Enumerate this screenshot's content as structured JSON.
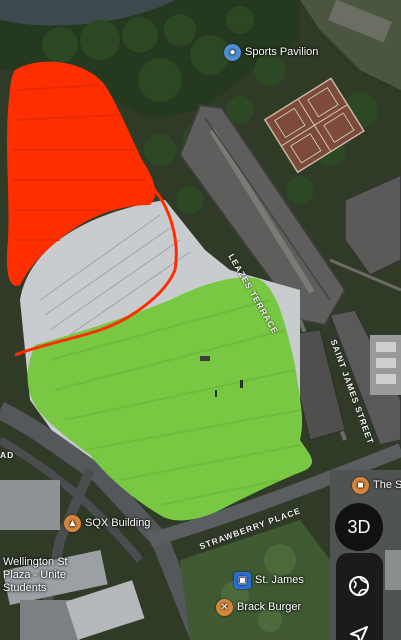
{
  "labels": {
    "sports_pavilion": "Sports Pavilion",
    "sqx_building": "SQX Building",
    "wellington": "Wellington St\nPlaza - Unite\nStudents",
    "st_james": "St. James",
    "brack_burger": "Brack Burger",
    "the_s": "The S"
  },
  "roads": {
    "leazes_terrace": "LEAZES TERRACE",
    "saint_james_street": "SAINT JAMES STREET",
    "strawberry_place": "STRAWBERRY PLACE",
    "ad": "AD"
  },
  "controls": {
    "three_d": "3D"
  },
  "icons": {
    "pavilion": "place-pin-icon",
    "sqx": "school-icon",
    "st_james": "metro-icon",
    "brack_burger": "restaurant-icon",
    "the_s": "store-icon",
    "globe": "globe-icon",
    "locate": "location-arrow-icon"
  },
  "colors": {
    "red_scribble": "#ff2e00",
    "green_scribble": "#79c843",
    "pin_blue": "#4f8fd6",
    "pin_orange": "#d8873c",
    "metro_blue": "#2a6fd6"
  }
}
